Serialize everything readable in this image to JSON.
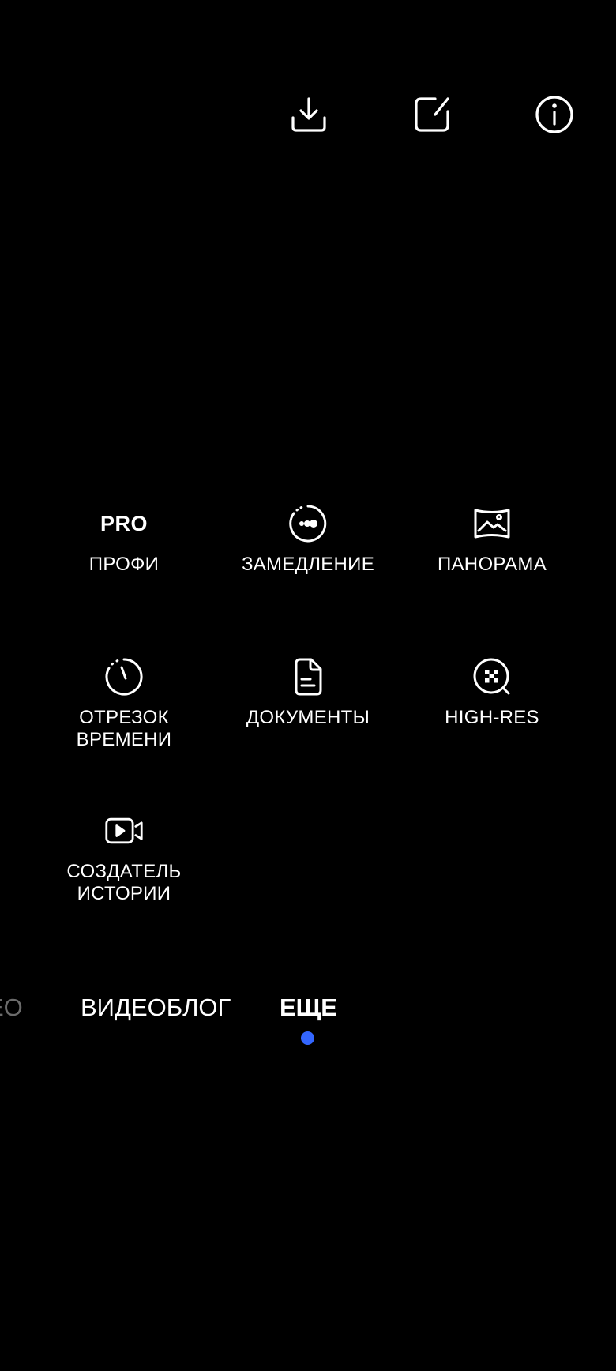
{
  "toolbar": {
    "download_icon": "download-icon",
    "edit_icon": "edit-icon",
    "info_icon": "info-icon"
  },
  "modes": [
    {
      "id": "pro",
      "badge": "PRO",
      "label": "ПРОФИ"
    },
    {
      "id": "slowmo",
      "icon": "slow-motion-icon",
      "label": "ЗАМЕДЛЕНИЕ"
    },
    {
      "id": "panorama",
      "icon": "panorama-icon",
      "label": "ПАНОРАМА"
    },
    {
      "id": "timelapse",
      "icon": "timelapse-icon",
      "label": "ОТРЕЗОК\nВРЕМЕНИ"
    },
    {
      "id": "documents",
      "icon": "document-icon",
      "label": "ДОКУМЕНТЫ"
    },
    {
      "id": "highres",
      "icon": "high-res-icon",
      "label": "HIGH-RES"
    },
    {
      "id": "story",
      "icon": "story-creator-icon",
      "label": "СОЗДАТЕЛЬ\nИСТОРИИ"
    }
  ],
  "mode_switcher": {
    "partial_label": "ЕО",
    "vlog_label": "ВИДЕОБЛОГ",
    "more_label": "ЕЩЕ",
    "active": "ЕЩЕ"
  },
  "colors": {
    "background": "#000000",
    "text": "#ffffff",
    "inactive_text": "#6b6b6b",
    "accent": "#3366ff"
  }
}
